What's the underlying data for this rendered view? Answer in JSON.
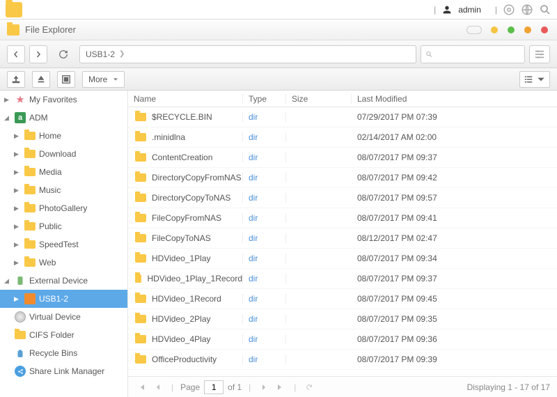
{
  "os": {
    "username": "admin"
  },
  "window": {
    "title": "File Explorer"
  },
  "breadcrumb": {
    "item": "USB1-2"
  },
  "toolbar": {
    "more_label": "More"
  },
  "search": {
    "placeholder": ""
  },
  "sidebar": {
    "my_favorites": "My Favorites",
    "adm": "ADM",
    "adm_children": [
      "Home",
      "Download",
      "Media",
      "Music",
      "PhotoGallery",
      "Public",
      "SpeedTest",
      "Web"
    ],
    "external_device": "External Device",
    "usb": "USB1-2",
    "virtual_device": "Virtual Device",
    "cifs_folder": "CIFS Folder",
    "recycle_bins": "Recycle Bins",
    "share_link_manager": "Share Link Manager"
  },
  "columns": {
    "name": "Name",
    "type": "Type",
    "size": "Size",
    "modified": "Last Modified"
  },
  "rows": [
    {
      "name": "$RECYCLE.BIN",
      "type": "dir",
      "size": "",
      "modified": "07/29/2017 PM 07:39"
    },
    {
      "name": ".minidlna",
      "type": "dir",
      "size": "",
      "modified": "02/14/2017 AM 02:00"
    },
    {
      "name": "ContentCreation",
      "type": "dir",
      "size": "",
      "modified": "08/07/2017 PM 09:37"
    },
    {
      "name": "DirectoryCopyFromNAS",
      "type": "dir",
      "size": "",
      "modified": "08/07/2017 PM 09:42"
    },
    {
      "name": "DirectoryCopyToNAS",
      "type": "dir",
      "size": "",
      "modified": "08/07/2017 PM 09:57"
    },
    {
      "name": "FileCopyFromNAS",
      "type": "dir",
      "size": "",
      "modified": "08/07/2017 PM 09:41"
    },
    {
      "name": "FileCopyToNAS",
      "type": "dir",
      "size": "",
      "modified": "08/12/2017 PM 02:47"
    },
    {
      "name": "HDVideo_1Play",
      "type": "dir",
      "size": "",
      "modified": "08/07/2017 PM 09:34"
    },
    {
      "name": "HDVideo_1Play_1Record",
      "type": "dir",
      "size": "",
      "modified": "08/07/2017 PM 09:37"
    },
    {
      "name": "HDVideo_1Record",
      "type": "dir",
      "size": "",
      "modified": "08/07/2017 PM 09:45"
    },
    {
      "name": "HDVideo_2Play",
      "type": "dir",
      "size": "",
      "modified": "08/07/2017 PM 09:35"
    },
    {
      "name": "HDVideo_4Play",
      "type": "dir",
      "size": "",
      "modified": "08/07/2017 PM 09:36"
    },
    {
      "name": "OfficeProductivity",
      "type": "dir",
      "size": "",
      "modified": "08/07/2017 PM 09:39"
    }
  ],
  "pager": {
    "page_label": "Page",
    "current": "1",
    "of_label": "of 1",
    "display": "Displaying 1 - 17 of 17"
  }
}
